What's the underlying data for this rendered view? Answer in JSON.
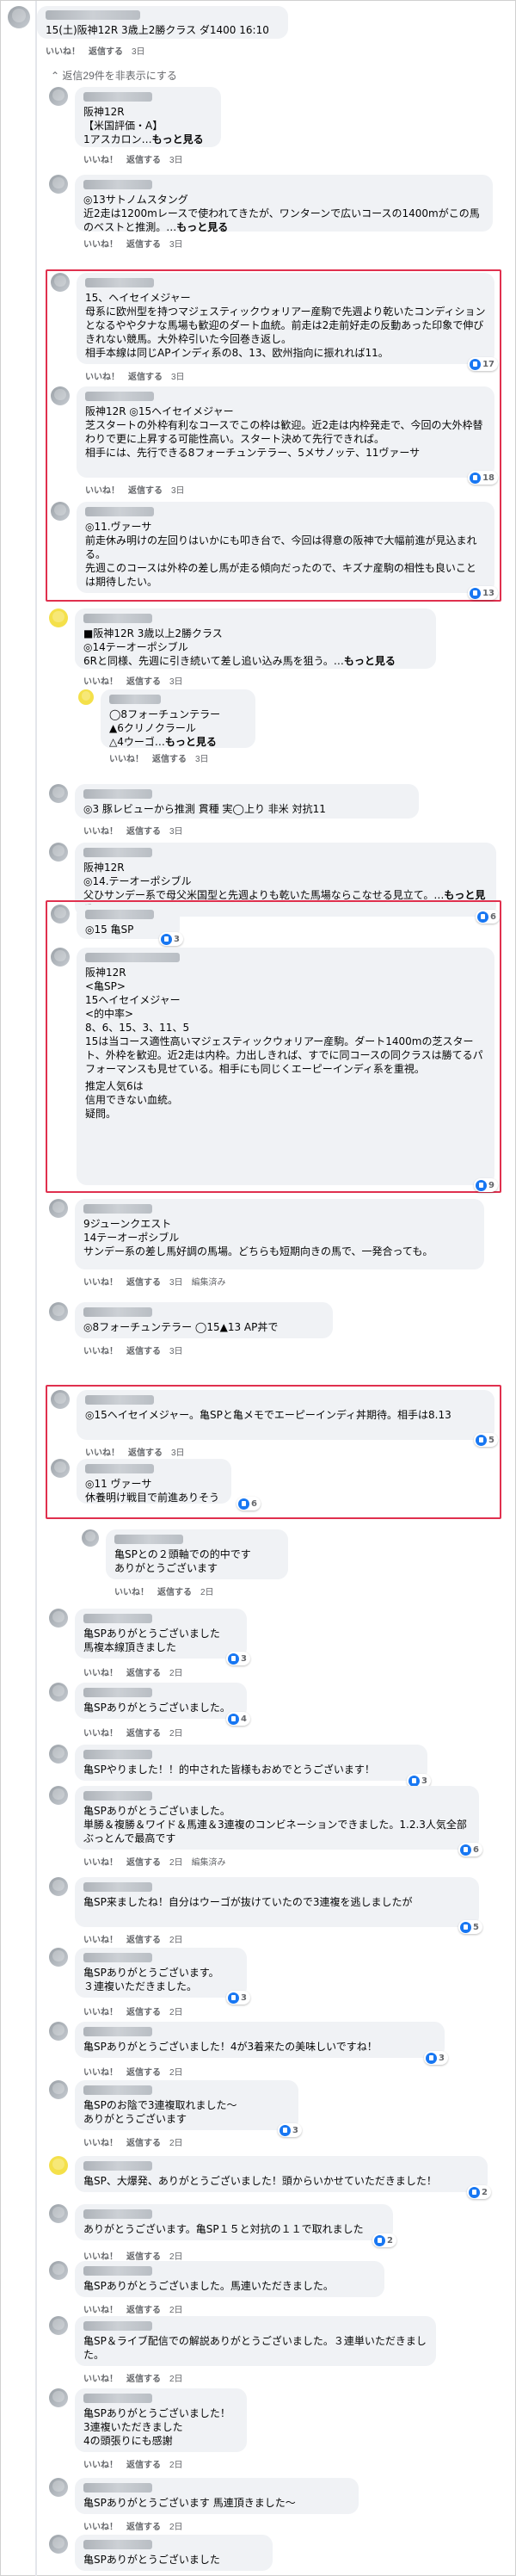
{
  "post": {
    "title": "15(土)阪神12R 3歳上2勝クラス ダ1400 16:10",
    "meta": [
      "いいね！",
      "返信する",
      "3日"
    ]
  },
  "hidden_replies": "⌃ 返信29件を非表示にする",
  "meta3": [
    "いいね！",
    "返信する",
    "3日"
  ],
  "meta2": [
    "いいね！",
    "返信する",
    "2日"
  ],
  "meta2e": [
    "いいね！",
    "返信する",
    "2日",
    "編集済み"
  ],
  "meta3e": [
    "いいね！",
    "返信する",
    "3日",
    "編集済み"
  ],
  "more": "もっと見る",
  "comments": [
    {
      "lines": [
        "阪神12R",
        "【米国評価・A】",
        "1アスカロン…"
      ],
      "more": true
    },
    {
      "lines": [
        "◎13サトノムスタング",
        "近2走は1200mレースで使われてきたが、ワンターンで広いコースの1400mがこの馬のベストと推測。…"
      ],
      "more": true
    },
    {
      "lines": [
        "15、ヘイセイメジャー",
        "母系に欧州型を持つマジェスティックウォリアー産駒で先週より乾いたコンディションとなるやや夕ナな馬場も歓迎のダート血統。前走は2走前好走の反動あった印象で伸びきれない競馬。大外枠引いた今回巻き返し。",
        "相手本線は同じAPインディ系の8、13、欧州指向に振れれば11。"
      ],
      "reactions": "17"
    },
    {
      "lines": [
        "阪神12R ◎15ヘイセイメジャー",
        "芝スタートの外枠有利なコースでこの枠は歓迎。近2走は内枠発走で、今回の大外枠替わりで更に上昇する可能性高い。スタート決めて先行できれば。",
        "相手には、先行できる8フォーチュンテラー、5メサノッテ、11ヴァーサ"
      ],
      "reactions": "18"
    },
    {
      "lines": [
        "◎11.ヴァーサ",
        "前走休み明けの左回りはいかにも叩き台で、今回は得意の阪神で大幅前進が見込まれる。",
        "先週このコースは外枠の差し馬が走る傾向だったので、キズナ産駒の相性も良いことは期待したい。"
      ],
      "reactions": "13"
    },
    {
      "lines": [
        "■阪神12R 3歳以上2勝クラス",
        "◎14テーオーポシブル",
        "6Rと同様、先週に引き続いて差し追い込み馬を狙う。…"
      ],
      "more": true
    },
    {
      "lines": [
        "◯8フォーチュンテラー",
        "▲6クリノクラール",
        "△4ウーゴ…"
      ],
      "more": true
    },
    {
      "lines": [
        "◎3 豚レビューから推測 貫種 実◯上り 非米 対抗11"
      ]
    },
    {
      "lines": [
        "阪神12R",
        "◎14.テーオーポシブル",
        "父ひサンデー系で母父米国型と先週よりも乾いた馬場ならこなせる見立て。…"
      ],
      "more": true,
      "reactions": "6"
    },
    {
      "lines": [
        "◎15 亀SP"
      ],
      "reactions": "3"
    },
    {
      "lines": [
        "阪神12R",
        "<亀SP>",
        "15ヘイセイメジャー",
        "",
        "<的中率>",
        "8、6、15、3、11、5",
        "",
        "15は当コース適性高いマジェスティックウォリアー産駒。ダート1400mの芝スタート、外枠を歓迎。近2走は内枠。力出しきれば、すでに同コースの同クラスは勝てるパフォーマンスも見せている。相手にも同じくエーピーインディ系を重視。",
        "推定人気6は",
        "信用できない血統。",
        "疑問。"
      ],
      "reactions": "9"
    },
    {
      "lines": [
        "9ジューンクエスト",
        "14テーオーポシブル",
        "サンデー系の差し馬好調の馬場。どちらも短期向きの馬で、一発合っても。"
      ]
    },
    {
      "lines": [
        "◎8フォーチュンテラー ◯15▲13 AP丼で"
      ]
    },
    {
      "lines": [
        "◎15ヘイセイメジャー。亀SPと亀メモでエーピーインディ丼期待。相手は8.13"
      ],
      "reactions": "5"
    },
    {
      "lines": [
        "◎11 ヴァーサ",
        "休養明け戦目で前進ありそう"
      ],
      "reactions": "6"
    },
    {
      "lines": [
        "亀SPとの２頭軸での的中です",
        "ありがとうございます"
      ]
    },
    {
      "lines": [
        "亀SPありがとうございました",
        "馬複本線頂きました"
      ],
      "reactions": "3"
    },
    {
      "lines": [
        "亀SPありがとうございました。"
      ],
      "reactions": "4"
    },
    {
      "lines": [
        "亀SPやりました！！的中された皆様もおめでとうございます！"
      ],
      "reactions": "3"
    },
    {
      "lines": [
        "亀SPありがとうございました。",
        "単勝＆複勝＆ワイド＆馬連＆3連複のコンビネーションできました。1.2.3人気全部ぶっとんで最高です"
      ],
      "reactions": "6"
    },
    {
      "lines": [
        "亀SP来ましたね！自分はウーゴが抜けていたので3連複を逃しましたが"
      ],
      "reactions": "5"
    },
    {
      "lines": [
        "亀SPありがとうございます。",
        "３連複いただきました。"
      ],
      "reactions": "3"
    },
    {
      "lines": [
        "亀SPありがとうございました！4が3着来たの美味しいですね！"
      ],
      "reactions": "3"
    },
    {
      "lines": [
        "亀SPのお陰で3連複取れました〜",
        "ありがとうございます"
      ],
      "reactions": "3"
    },
    {
      "lines": [
        "亀SP、大爆発、ありがとうございました！頭からいかせていただきました！"
      ],
      "reactions": "2"
    },
    {
      "lines": [
        "ありがとうございます。亀SP１５と対抗の１１で取れました"
      ],
      "reactions": "2"
    },
    {
      "lines": [
        "亀SPありがとうございました。馬連いただきました。"
      ]
    },
    {
      "lines": [
        "亀SP＆ライブ配信での解説ありがとうございました。３連単いただきました。"
      ]
    },
    {
      "lines": [
        "亀SPありがとうございました！",
        "3連複いただきました",
        "4の頭張りにも感謝"
      ]
    },
    {
      "lines": [
        "亀SPありがとうございます",
        "馬連頂きました〜"
      ]
    },
    {
      "lines": [
        "亀SPありがとうございました"
      ]
    }
  ]
}
